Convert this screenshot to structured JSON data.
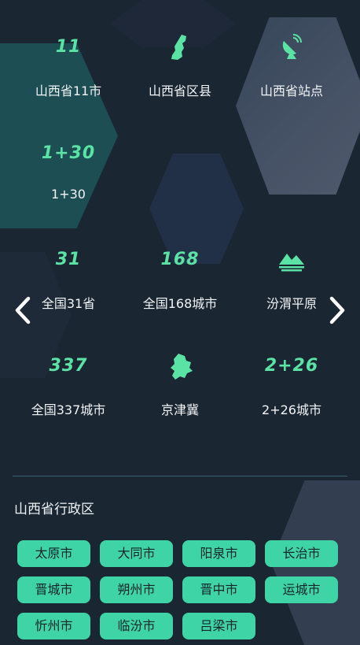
{
  "regions": [
    {
      "value": "11",
      "label": "山西省11市"
    },
    {
      "icon": "shanxi-map-icon",
      "label": "山西省区县"
    },
    {
      "icon": "satellite-dish-icon",
      "label": "山西省站点"
    },
    {
      "value": "1+30",
      "label": "1+30"
    },
    {
      "value": "31",
      "label": "全国31省"
    },
    {
      "value": "168",
      "label": "全国168城市"
    },
    {
      "icon": "plain-mountain-icon",
      "label": "汾渭平原"
    },
    {
      "value": "337",
      "label": "全国337城市"
    },
    {
      "icon": "jingjinji-map-icon",
      "label": "京津冀"
    },
    {
      "value": "2+26",
      "label": "2+26城市"
    }
  ],
  "section": {
    "title": "山西省行政区"
  },
  "cities": [
    "太原市",
    "大同市",
    "阳泉市",
    "长治市",
    "晋城市",
    "朔州市",
    "晋中市",
    "运城市",
    "忻州市",
    "临汾市",
    "吕梁市"
  ],
  "colors": {
    "accent": "#5be3a5",
    "chip": "#3fd4a6",
    "background": "#1b2633"
  }
}
